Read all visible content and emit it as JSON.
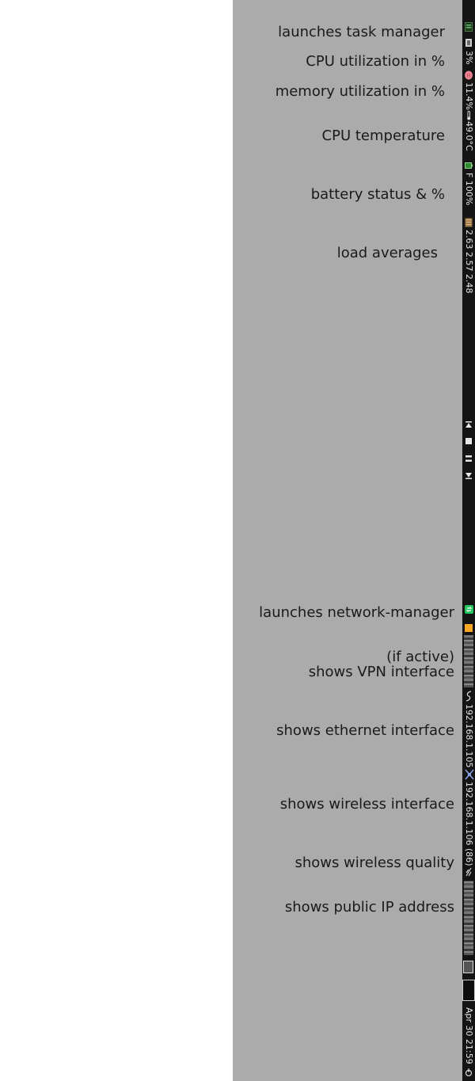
{
  "annotations": {
    "task_manager": "launches task manager",
    "cpu_util": "CPU utilization in %",
    "mem_util": "memory utilization in %",
    "cpu_temp": "CPU temperature",
    "battery": "battery status & %",
    "load": "load averages",
    "network_manager": "launches network-manager",
    "vpn_line1": "(if active)",
    "vpn_line2": "shows VPN interface",
    "ethernet": "shows ethernet interface",
    "wireless": "shows wireless interface",
    "wireless_quality": "shows wireless quality",
    "public_ip": "shows public IP address"
  },
  "statusbar": {
    "cpu_value": "3%",
    "mem_value": "11.4%",
    "temp_value": "49.0°C",
    "battery_value": "F 100%",
    "load_value": "2.63 2.57 2.48",
    "ethernet_ip": "192.168.1.105",
    "wireless_ip": "192.168.1.106 (86)",
    "clock": "Apr 30 21:59"
  },
  "colors": {
    "panel_bg": "#ababab",
    "bar_bg": "#141414",
    "network_icon": "#22c55e",
    "vpn_icon": "#f5a623"
  }
}
